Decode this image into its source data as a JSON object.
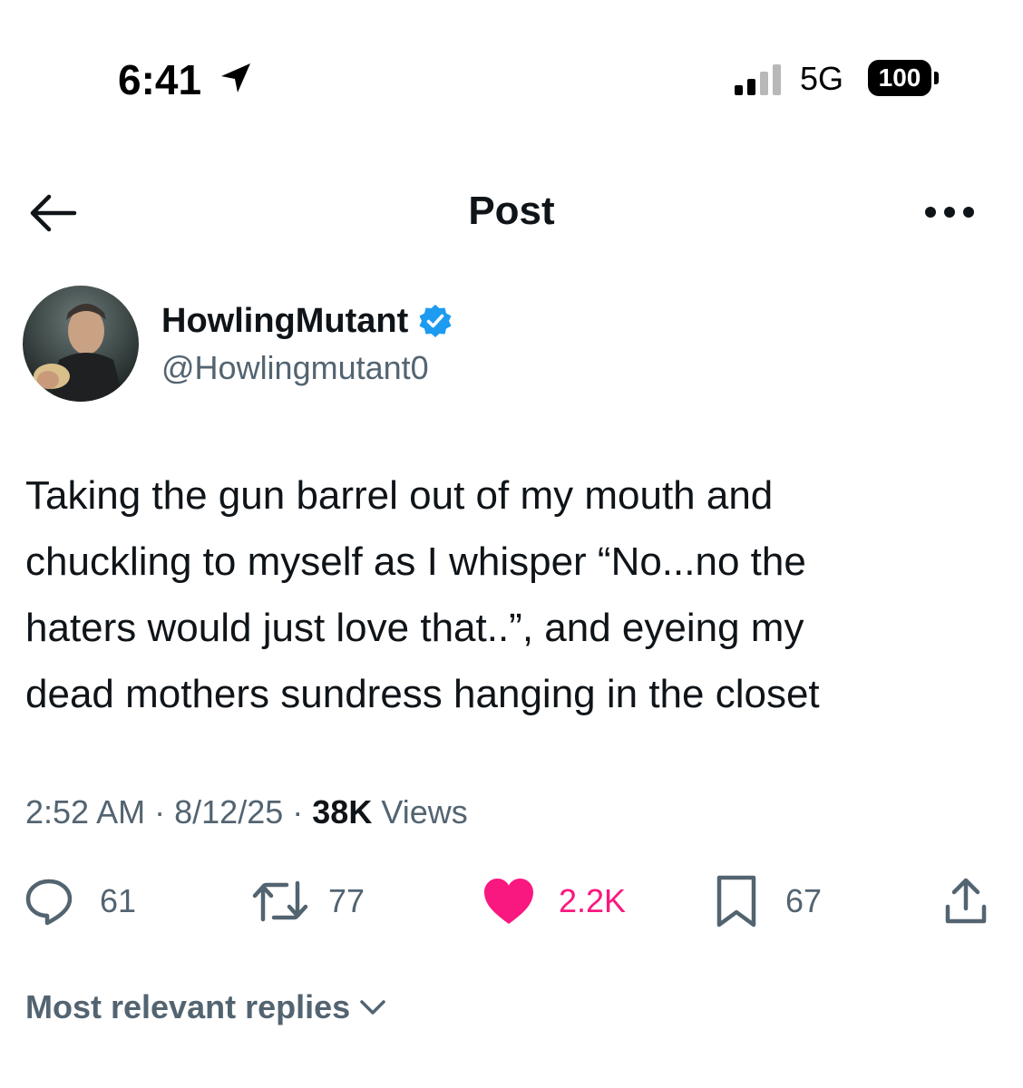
{
  "status_bar": {
    "time": "6:41",
    "network": "5G",
    "battery": "100",
    "signal_bars_active": 2,
    "signal_bars_total": 4
  },
  "header": {
    "title": "Post",
    "back_icon": "arrow-left-icon",
    "more_icon": "more-horizontal-icon"
  },
  "author": {
    "display_name": "HowlingMutant",
    "handle": "@Howlingmutant0",
    "verified": true,
    "verified_color": "#1d9bf0"
  },
  "post": {
    "lines": [
      "Taking the gun barrel out of my mouth and",
      "chuckling to myself as I whisper “No...no the",
      "haters would just love that..”, and eyeing my",
      "dead mothers sundress hanging in the closet"
    ],
    "time": "2:52 AM",
    "separator": "·",
    "date": "8/12/25",
    "views_count": "38K",
    "views_label": "Views"
  },
  "actions": {
    "replies": "61",
    "reposts": "77",
    "likes": "2.2K",
    "bookmarks": "67",
    "like_color": "#f91880"
  },
  "replies_sort": {
    "label": "Most relevant replies"
  }
}
